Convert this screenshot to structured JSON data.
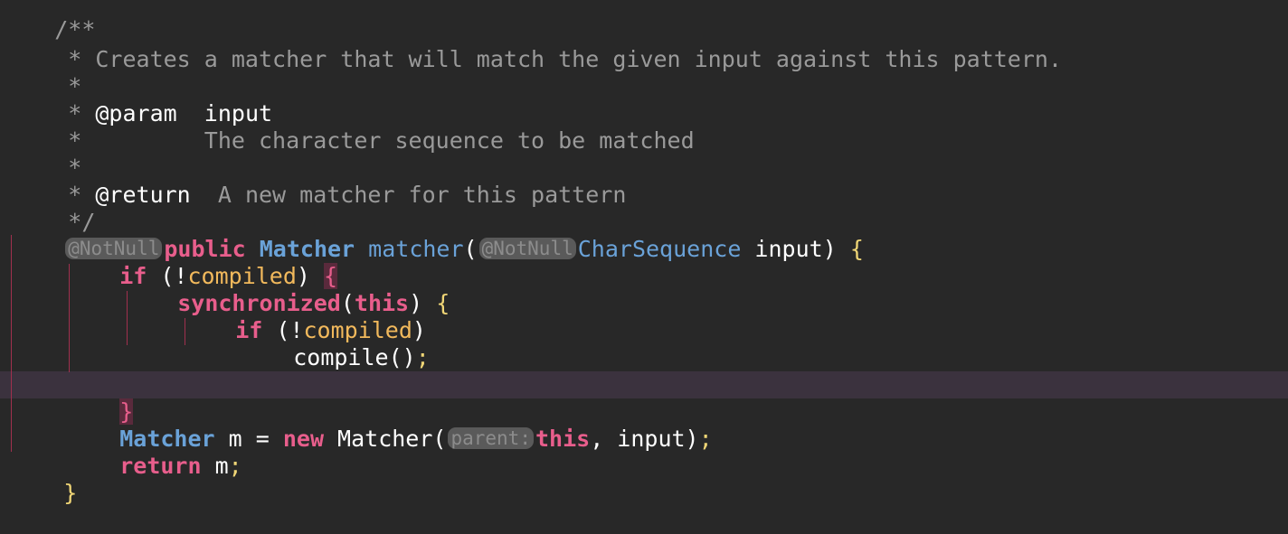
{
  "code": {
    "doc": {
      "open": "/**",
      "summary": " * Creates a matcher that will match the given input against this pattern.",
      "blank1": " *",
      "param_prefix": " * ",
      "param_tag": "@param",
      "param_name": "  input",
      "param_desc": " *         The character sequence to be matched",
      "blank2": " *",
      "return_prefix": " * ",
      "return_tag": "@return",
      "return_desc": "  A new matcher for this pattern",
      "close": " */"
    },
    "signature": {
      "hint_annotation": "@NotNull",
      "kw_public": "public",
      "return_type": "Matcher",
      "method_name": "matcher",
      "open_paren": "(",
      "param_hint": "@NotNull",
      "param_type": "CharSequence",
      "param_name": " input",
      "close_paren": ")",
      "open_brace": "{"
    },
    "body": {
      "if1_kw": "if",
      "if1_open": " (!",
      "if1_field": "compiled",
      "if1_close": ") ",
      "if1_brace": "{",
      "sync_kw": "synchronized",
      "sync_open": "(",
      "sync_this": "this",
      "sync_close": ") ",
      "sync_brace": "{",
      "if2_kw": "if",
      "if2_open": " (!",
      "if2_field": "compiled",
      "if2_close": ")",
      "compile_call": "compile",
      "compile_parens": "()",
      "compile_semi": ";",
      "sync_end_brace": "}",
      "if1_end_brace": "}",
      "decl_type": "Matcher",
      "decl_var": " m = ",
      "decl_new": "new",
      "decl_ctor": " Matcher(",
      "decl_hint": "parent:",
      "decl_this": "this",
      "decl_rest": ", input)",
      "decl_semi": ";",
      "return_kw": "return",
      "return_rest": " m",
      "return_semi": ";",
      "method_end_brace": "}"
    }
  }
}
